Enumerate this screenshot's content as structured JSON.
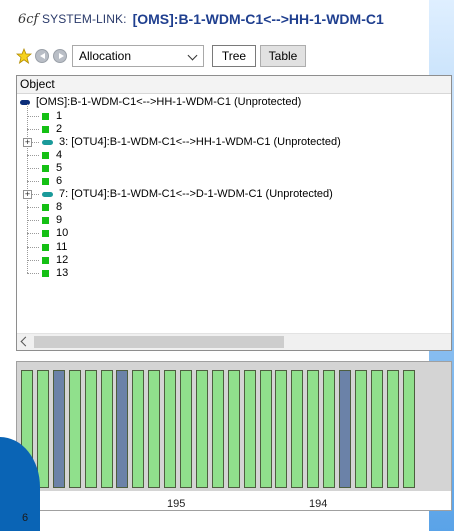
{
  "window": {
    "icon_glyph": "6cf",
    "title_prefix": "SYSTEM-LINK:",
    "title": "[OMS]:B-1-WDM-C1<-->HH-1-WDM-C1"
  },
  "toolbar": {
    "favorite_icon": "star-icon",
    "back_icon": "nav-back-icon",
    "forward_icon": "nav-forward-icon",
    "dropdown_value": "Allocation",
    "tree_label": "Tree",
    "table_label": "Table"
  },
  "tree": {
    "column_header": "Object",
    "root": {
      "label": "[OMS]:B-1-WDM-C1<-->HH-1-WDM-C1 (Unprotected)"
    },
    "children": [
      {
        "label": "1",
        "kind": "leaf"
      },
      {
        "label": "2",
        "kind": "leaf"
      },
      {
        "label": "3: [OTU4]:B-1-WDM-C1<-->HH-1-WDM-C1 (Unprotected)",
        "kind": "link"
      },
      {
        "label": "4",
        "kind": "leaf"
      },
      {
        "label": "5",
        "kind": "leaf"
      },
      {
        "label": "6",
        "kind": "leaf"
      },
      {
        "label": "7: [OTU4]:B-1-WDM-C1<-->D-1-WDM-C1 (Unprotected)",
        "kind": "link"
      },
      {
        "label": "8",
        "kind": "leaf"
      },
      {
        "label": "9",
        "kind": "leaf"
      },
      {
        "label": "10",
        "kind": "leaf"
      },
      {
        "label": "11",
        "kind": "leaf"
      },
      {
        "label": "12",
        "kind": "leaf"
      },
      {
        "label": "13",
        "kind": "leaf"
      }
    ]
  },
  "slots": {
    "states": [
      "free",
      "free",
      "used",
      "free",
      "free",
      "free",
      "used",
      "free",
      "free",
      "free",
      "free",
      "free",
      "free",
      "free",
      "free",
      "free",
      "free",
      "free",
      "free",
      "free",
      "used",
      "free",
      "free",
      "free",
      "free"
    ],
    "colors": {
      "free": "#90e08c",
      "used": "#6b82a8"
    },
    "axis_labels": [
      "6",
      "195",
      "194"
    ]
  }
}
